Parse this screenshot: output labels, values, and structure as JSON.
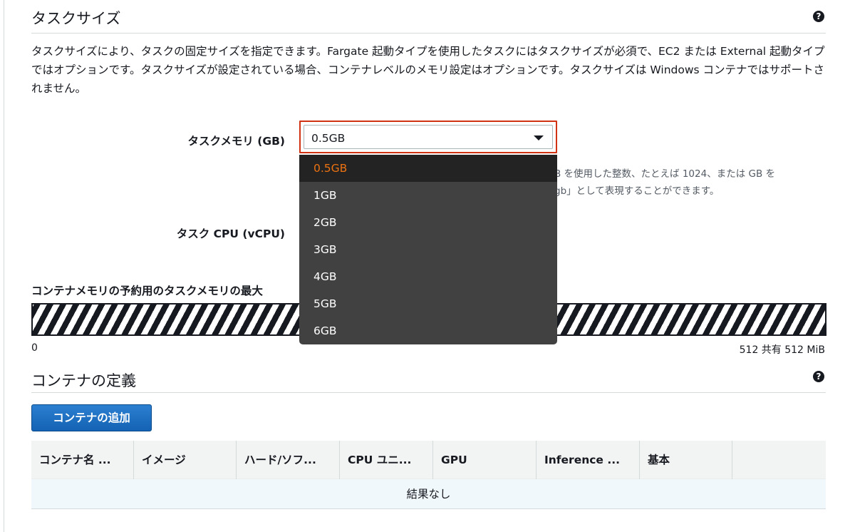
{
  "task_size": {
    "title": "タスクサイズ",
    "description": "タスクサイズにより、タスクの固定サイズを指定できます。Fargate 起動タイプを使用したタスクにはタスクサイズが必須で、EC2 または External 起動タイプではオプションです。タスクサイズが設定されている場合、コンテナレベルのメモリ設定はオプションです。タスクサイズは Windows コンテナではサポートされません。",
    "memory_label": "タスクメモリ (GB)",
    "memory_value": "0.5GB",
    "memory_hint_line1": "B を使用した整数、たとえば 1024、または GB を",
    "memory_hint_line2": "gb」として表現することができます。",
    "cpu_label": "タスク CPU (vCPU)",
    "memory_options": [
      "0.5GB",
      "1GB",
      "2GB",
      "3GB",
      "4GB",
      "5GB",
      "6GB"
    ],
    "selected_option": "0.5GB",
    "bar_label": "コンテナメモリの予約用のタスクメモリの最大",
    "bar_min": "0",
    "bar_max": "512 共有 512 MiB"
  },
  "containers": {
    "title": "コンテナの定義",
    "add_button": "コンテナの追加",
    "columns": [
      "コンテナ名 ...",
      "イメージ",
      "ハード/ソフ...",
      "CPU ユニ...",
      "GPU",
      "Inference ...",
      "基本",
      ""
    ],
    "empty_text": "結果なし"
  },
  "icons": {
    "help": "help-icon",
    "caret": "caret-down-icon"
  },
  "colors": {
    "accent_border": "#d13212",
    "selected_option": "#ec7211",
    "primary_button": "#1166bb"
  }
}
